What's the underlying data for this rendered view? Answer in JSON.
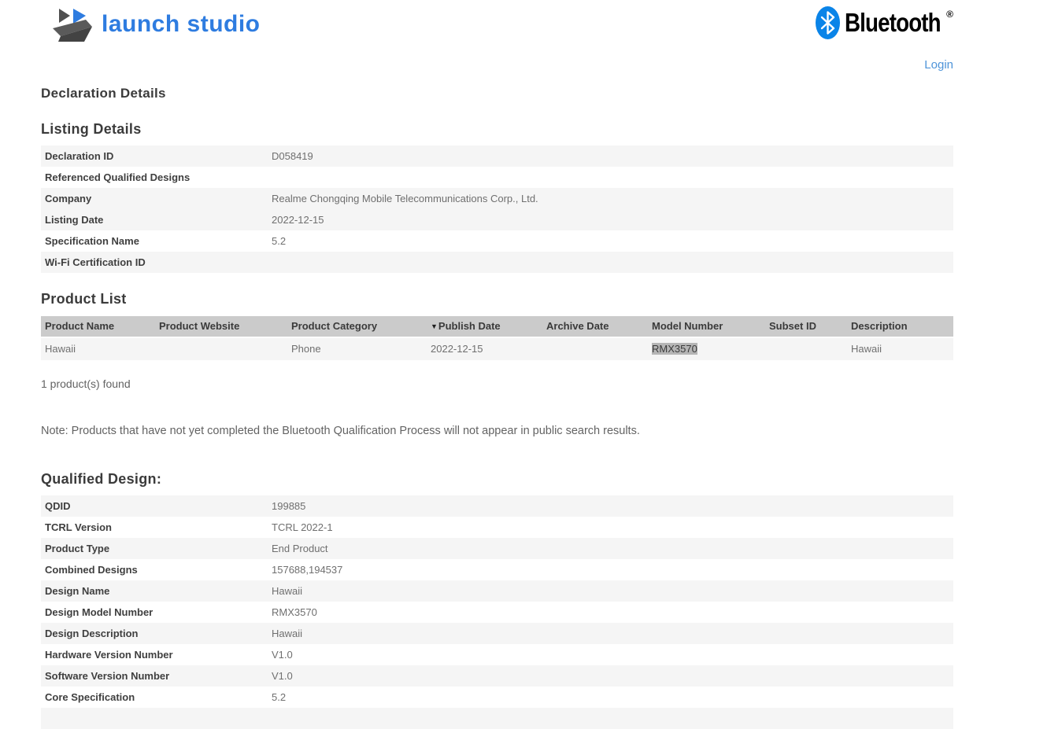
{
  "header": {
    "logo": {
      "text": "launch studio"
    },
    "bluetooth": {
      "wordmark": "Bluetooth",
      "registered": "®"
    },
    "login_label": "Login"
  },
  "page_title": "Declaration Details",
  "listing_details": {
    "heading": "Listing Details",
    "rows": [
      {
        "label": "Declaration ID",
        "value": "D058419",
        "shaded": true
      },
      {
        "label": "Referenced Qualified Designs",
        "value": "",
        "shaded": false
      },
      {
        "label": "Company",
        "value": "Realme Chongqing Mobile Telecommunications Corp., Ltd.",
        "shaded": true
      },
      {
        "label": "Listing Date",
        "value": "2022-12-15",
        "shaded": true
      },
      {
        "label": "Specification Name",
        "value": "5.2",
        "shaded": false
      },
      {
        "label": "Wi-Fi Certification ID",
        "value": "",
        "shaded": true
      }
    ]
  },
  "product_list": {
    "heading": "Product List",
    "sort_indicator": "▼",
    "columns": [
      {
        "label": "Product Name",
        "sorted": false
      },
      {
        "label": "Product Website",
        "sorted": false
      },
      {
        "label": "Product Category",
        "sorted": false
      },
      {
        "label": "Publish Date",
        "sorted": true
      },
      {
        "label": "Archive Date",
        "sorted": false
      },
      {
        "label": "Model Number",
        "sorted": false
      },
      {
        "label": "Subset ID",
        "sorted": false
      },
      {
        "label": "Description",
        "sorted": false
      }
    ],
    "rows": [
      {
        "product_name": "Hawaii",
        "product_website": "",
        "product_category": "Phone",
        "publish_date": "2022-12-15",
        "archive_date": "",
        "model_number": "RMX3570",
        "model_number_selected": true,
        "subset_id": "",
        "description": "Hawaii"
      }
    ],
    "count_text": "1 product(s) found"
  },
  "note_text": "Note: Products that have not yet completed the Bluetooth Qualification Process will not appear in public search results.",
  "qualified_design": {
    "heading": "Qualified Design:",
    "rows": [
      {
        "label": "QDID",
        "value": "199885",
        "shaded": true
      },
      {
        "label": "TCRL Version",
        "value": "TCRL 2022-1",
        "shaded": false
      },
      {
        "label": "Product Type",
        "value": "End Product",
        "shaded": true
      },
      {
        "label": "Combined Designs",
        "value": "157688,194537",
        "shaded": false
      },
      {
        "label": "Design Name",
        "value": "Hawaii",
        "shaded": true
      },
      {
        "label": "Design Model Number",
        "value": "RMX3570",
        "shaded": false
      },
      {
        "label": "Design Description",
        "value": "Hawaii",
        "shaded": true
      },
      {
        "label": "Hardware Version Number",
        "value": "V1.0",
        "shaded": false
      },
      {
        "label": "Software Version Number",
        "value": "V1.0",
        "shaded": true
      },
      {
        "label": "Core Specification",
        "value": "5.2",
        "shaded": false
      },
      {
        "label": "",
        "value": "",
        "shaded": true
      }
    ]
  },
  "colors": {
    "logo_blue": "#2e7ce0",
    "bluetooth_blue": "#0a84e8",
    "login_link": "#4e94d9",
    "row_shade": "#f5f5f5",
    "table_header_bg": "#cbcbcb",
    "selection_highlight": "#b5b5b5",
    "label_text": "#3f3f3f",
    "value_text": "#6f6f6f"
  }
}
